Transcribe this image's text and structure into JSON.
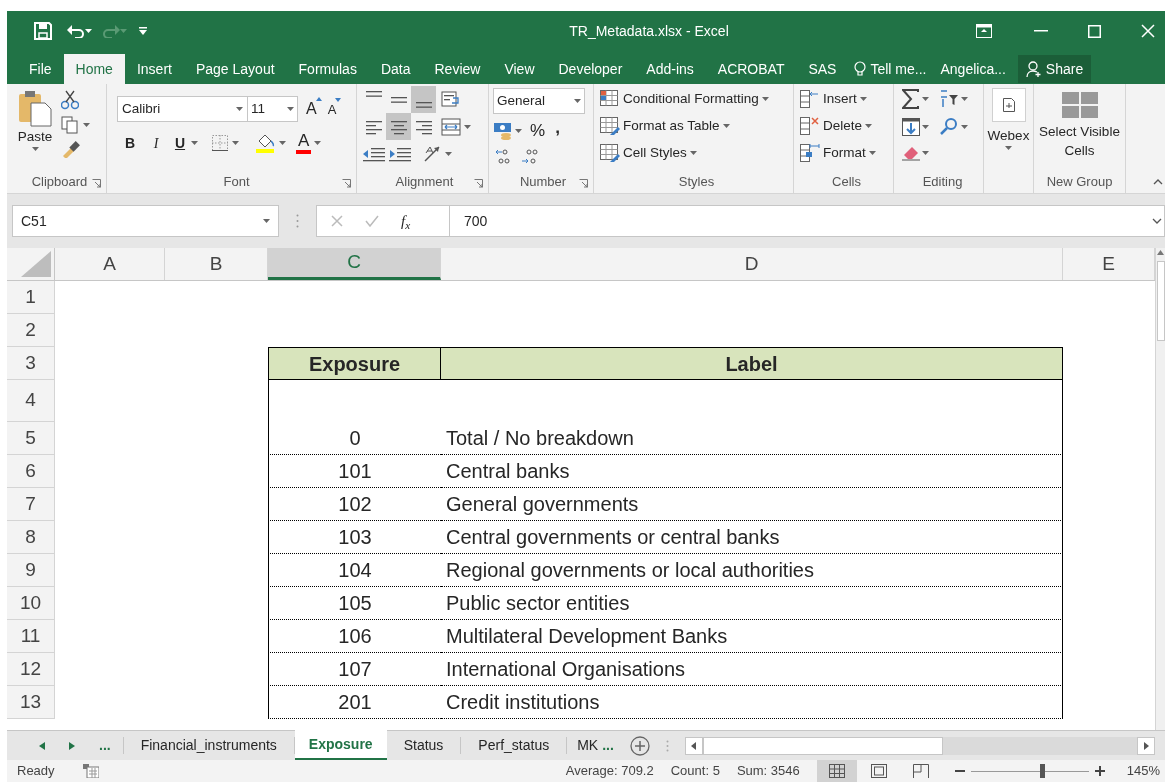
{
  "title_bar": {
    "title": "TR_Metadata.xlsx - Excel",
    "redo_disabled": true
  },
  "ribbon_tabs": [
    {
      "label": "File",
      "selected": false
    },
    {
      "label": "Home",
      "selected": true
    },
    {
      "label": "Insert",
      "selected": false
    },
    {
      "label": "Page Layout",
      "selected": false
    },
    {
      "label": "Formulas",
      "selected": false
    },
    {
      "label": "Data",
      "selected": false
    },
    {
      "label": "Review",
      "selected": false
    },
    {
      "label": "View",
      "selected": false
    },
    {
      "label": "Developer",
      "selected": false
    },
    {
      "label": "Add-ins",
      "selected": false
    },
    {
      "label": "ACROBAT",
      "selected": false
    },
    {
      "label": "SAS",
      "selected": false
    }
  ],
  "tell_me": "Tell me...",
  "account": "Angelica...",
  "share": "Share",
  "ribbon": {
    "clipboard": {
      "paste": "Paste",
      "label": "Clipboard"
    },
    "font": {
      "name": "Calibri",
      "size": "11",
      "grow": "A",
      "shrink": "A",
      "bold": "B",
      "italic": "I",
      "underline": "U",
      "color_letter": "A",
      "label": "Font"
    },
    "alignment": {
      "vertical": [
        {
          "selected": false
        },
        {
          "selected": false
        },
        {
          "selected": true
        }
      ],
      "horizontal": [
        {
          "selected": false
        },
        {
          "selected": true
        },
        {
          "selected": false
        }
      ],
      "label": "Alignment"
    },
    "number": {
      "format": "General",
      "percent": "%",
      "comma": ",",
      "label": "Number"
    },
    "styles": {
      "items": [
        "Conditional Formatting",
        "Format as Table",
        "Cell Styles"
      ],
      "label": "Styles"
    },
    "cells": {
      "items": [
        "Insert",
        "Delete",
        "Format"
      ],
      "label": "Cells"
    },
    "editing": {
      "label": "Editing"
    },
    "webex": {
      "label": "Webex"
    },
    "new_group": {
      "button": "Select Visible Cells",
      "label": "New Group"
    }
  },
  "formula_bar": {
    "name_box": "C51",
    "fx": "f$_{x}$",
    "value": "700"
  },
  "columns": [
    {
      "label": "A",
      "selected": false
    },
    {
      "label": "B",
      "selected": false
    },
    {
      "label": "C",
      "selected": true
    },
    {
      "label": "D",
      "selected": false
    },
    {
      "label": "E",
      "selected": false
    }
  ],
  "rows": [
    {
      "number": "1",
      "kind": "empty"
    },
    {
      "number": "2",
      "kind": "empty"
    },
    {
      "number": "3",
      "kind": "header",
      "cells": [
        "Exposure",
        "Label"
      ]
    },
    {
      "number": "4",
      "kind": "spacer"
    },
    {
      "number": "5",
      "kind": "data",
      "cells": [
        "0",
        "Total / No breakdown"
      ]
    },
    {
      "number": "6",
      "kind": "data",
      "cells": [
        "101",
        "Central banks"
      ]
    },
    {
      "number": "7",
      "kind": "data",
      "cells": [
        "102",
        "General governments"
      ]
    },
    {
      "number": "8",
      "kind": "data",
      "cells": [
        "103",
        "Central governments or central banks"
      ]
    },
    {
      "number": "9",
      "kind": "data",
      "cells": [
        "104",
        "Regional governments or local authorities"
      ]
    },
    {
      "number": "10",
      "kind": "data",
      "cells": [
        "105",
        "Public sector entities"
      ]
    },
    {
      "number": "11",
      "kind": "data",
      "cells": [
        "106",
        "Multilateral Development Banks"
      ]
    },
    {
      "number": "12",
      "kind": "data",
      "cells": [
        "107",
        "International Organisations"
      ]
    },
    {
      "number": "13",
      "kind": "data",
      "cells": [
        "201",
        "Credit institutions"
      ]
    }
  ],
  "sheet_tabs": {
    "more_left": "...",
    "tabs": [
      {
        "label": "Financial_instruments",
        "selected": false
      },
      {
        "label": "Exposure",
        "selected": true
      },
      {
        "label": "Status",
        "selected": false
      },
      {
        "label": "Perf_status",
        "selected": false
      },
      {
        "label": "MK",
        "selected": false
      }
    ],
    "more_right": "..."
  },
  "status_bar": {
    "mode": "Ready",
    "average": "Average: 709.2",
    "count": "Count: 5",
    "sum": "Sum: 3546",
    "views": [
      {
        "selected": true
      },
      {
        "selected": false
      },
      {
        "selected": false
      }
    ],
    "zoom_slider": {
      "level": 0.6
    },
    "zoom": "145%"
  }
}
